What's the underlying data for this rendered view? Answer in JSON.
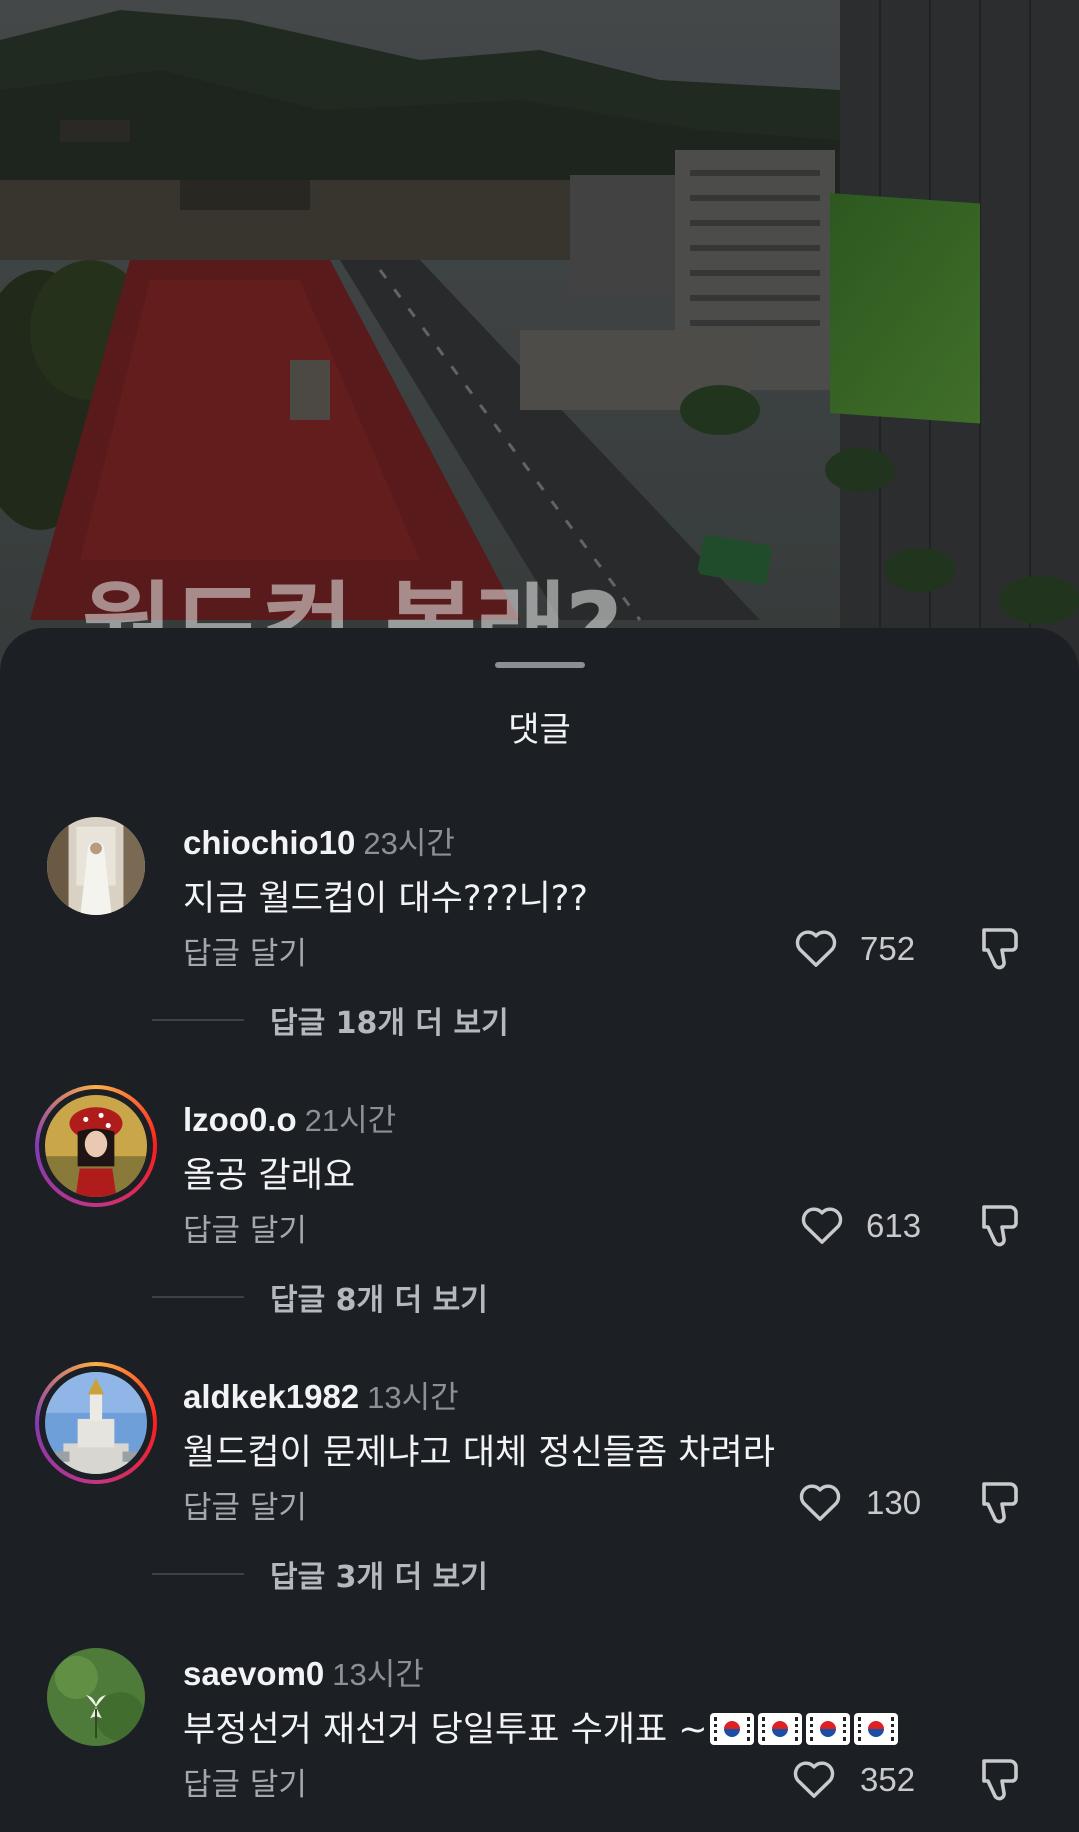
{
  "background": {
    "overlay_title": "월드컵 볼래?"
  },
  "sheet": {
    "title": "댓글"
  },
  "comments": [
    {
      "username": "chiochio10",
      "time": "23시간",
      "text": "지금 월드컵이 대수???니??",
      "reply_label": "답글 달기",
      "likes": "752",
      "more_replies": "답글 18개 더 보기",
      "avatar": "bride-photo"
    },
    {
      "username": "lzoo0.o",
      "time": "21시간",
      "text": "올공 갈래요",
      "reply_label": "답글 달기",
      "likes": "613",
      "more_replies": "답글 8개 더 보기",
      "avatar": "doll-with-red-hat",
      "story_ring": true
    },
    {
      "username": "aldkek1982",
      "time": "13시간",
      "text": "월드컵이 문제냐고 대체 정신들좀 차려라",
      "reply_label": "답글 달기",
      "likes": "130",
      "more_replies": "답글 3개 더 보기",
      "avatar": "monument-blue-sky",
      "story_ring": true
    },
    {
      "username": "saevom0",
      "time": "13시간",
      "text": "부정선거 재선거 당일투표 수개표 ~",
      "text_flags": [
        "kr-flag",
        "kr-flag",
        "kr-flag",
        "kr-flag"
      ],
      "reply_label": "답글 달기",
      "likes": "352",
      "avatar": "white-flower"
    }
  ],
  "icons": {
    "like": "heart-outline-icon",
    "dislike": "thumbs-down-outline-icon"
  },
  "colors": {
    "sheet_bg": "#1c1f24",
    "text_primary": "#f2f3f5",
    "text_secondary": "#8d9096",
    "story_ring": [
      "#fcb045",
      "#fd1d1d",
      "#c13584",
      "#833ab4"
    ]
  }
}
